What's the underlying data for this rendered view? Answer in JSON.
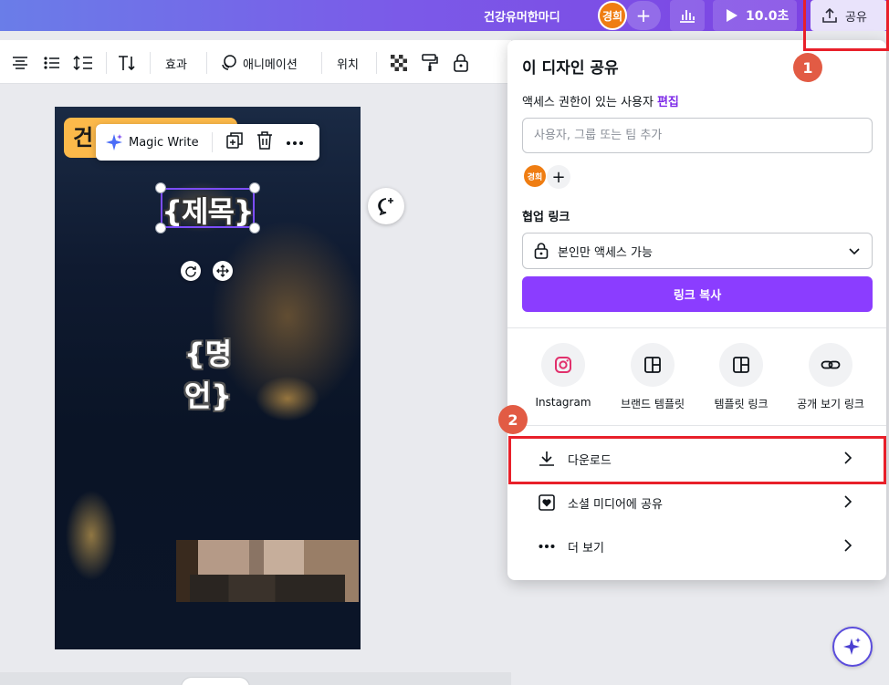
{
  "topbar": {
    "doc_title": "건강유머한마디",
    "user_initials": "경희",
    "add_label": "+",
    "duration": "10.0초",
    "share_label": "공유"
  },
  "toolbar": {
    "effects": "효과",
    "animation": "애니메이션",
    "position": "위치"
  },
  "canvas": {
    "badge_text": "건",
    "title_placeholder": "{제목}",
    "quote_placeholder": "{명언}",
    "context_toolbar": {
      "magic_write": "Magic Write"
    }
  },
  "share_panel": {
    "title": "이 디자인 공유",
    "access_label": "액세스 권한이 있는 사용자",
    "edit_link": "편집",
    "people_placeholder": "사용자, 그룹 또는 팀 추가",
    "member_initials": "경희",
    "collab_link_label": "협업 링크",
    "link_access": "본인만 액세스 가능",
    "copy_link": "링크 복사",
    "share_options": [
      {
        "label": "Instagram",
        "icon": "instagram-icon"
      },
      {
        "label": "브랜드 템플릿",
        "icon": "template-icon"
      },
      {
        "label": "템플릿 링크",
        "icon": "template-link-icon"
      },
      {
        "label": "공개 보기 링크",
        "icon": "link-icon"
      }
    ],
    "rows": [
      {
        "label": "다운로드",
        "icon": "download-icon"
      },
      {
        "label": "소셜 미디어에 공유",
        "icon": "heart-icon"
      },
      {
        "label": "더 보기",
        "icon": "more-icon"
      }
    ]
  },
  "annotations": {
    "step1": "1",
    "step2": "2",
    "highlight_color": "#e8202a",
    "badge_color": "#e25b44"
  },
  "colors": {
    "brand_purple": "#8b3dff",
    "edit_link": "#7d2ae8",
    "avatar_orange": "#ef7d12",
    "badge_yellow": "#fcb94a"
  }
}
